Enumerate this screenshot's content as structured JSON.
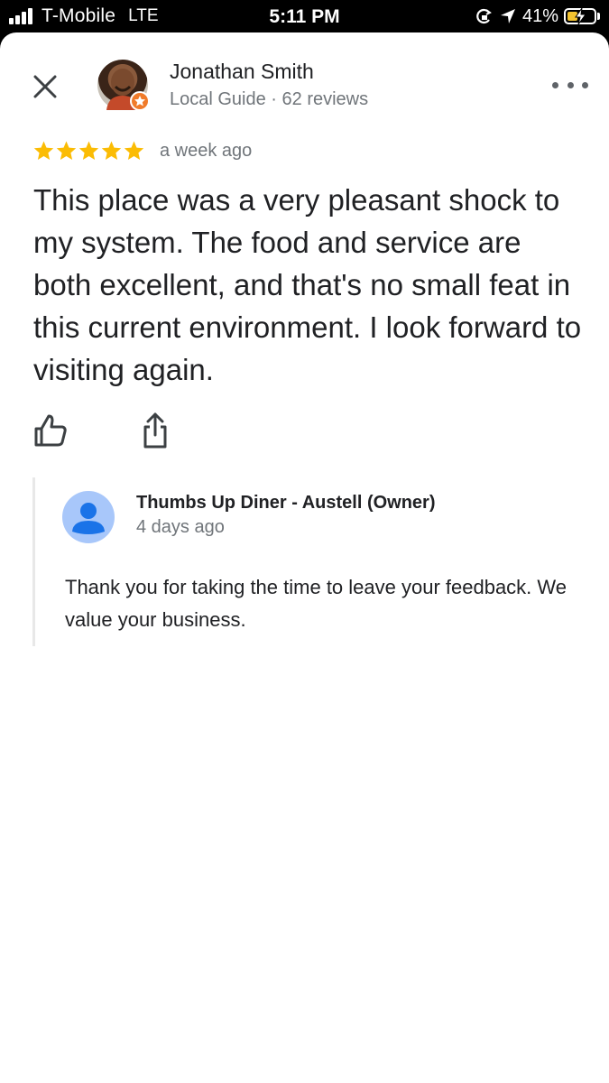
{
  "status_bar": {
    "carrier": "T-Mobile",
    "network": "LTE",
    "time": "5:11 PM",
    "battery": "41%",
    "battery_level": 0.41,
    "battery_color": "#f4c430",
    "icons": [
      "signal-bars-icon",
      "rotation-lock-icon",
      "location-arrow-icon",
      "battery-charging-icon"
    ]
  },
  "header": {
    "close_icon": "close-icon",
    "more_icon": "more-horizontal-icon"
  },
  "reviewer": {
    "name": "Jonathan Smith",
    "meta": "Local Guide · 62 reviews",
    "badge_color": "#f07b2a"
  },
  "review": {
    "rating": 5,
    "star_color": "#fbbc04",
    "date": "a week ago",
    "text": "This place was a very pleasant shock to my system. The food and service are both excellent, and that's no small feat in this current environment. I look forward to visiting again."
  },
  "actions": {
    "like_icon": "thumbs-up-icon",
    "share_icon": "share-icon"
  },
  "owner_response": {
    "name": "Thumbs Up Diner - Austell (Owner)",
    "date": "4 days ago",
    "text": "Thank you for taking the time to leave your feedback. We value your business.",
    "avatar_color": "#a8c7fa",
    "avatar_icon": "person-icon"
  }
}
